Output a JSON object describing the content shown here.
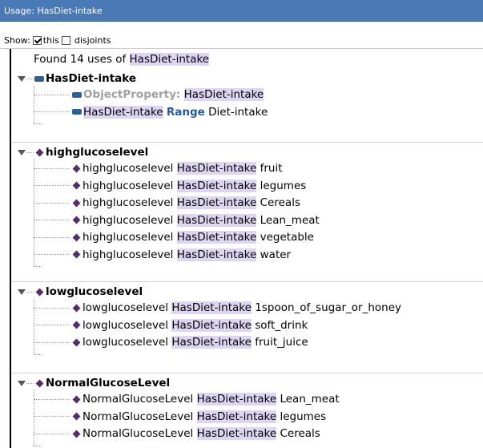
{
  "title": "Usage: HasDiet-intake",
  "toolbar": {
    "show_label": "Show:",
    "this_label": "this",
    "disjoints_label": "disjoints",
    "this_checked": true,
    "disjoints_checked": false
  },
  "found": {
    "prefix": "Found 14 uses of",
    "term": "HasDiet-intake"
  },
  "sections": [
    {
      "title": "HasDiet-intake",
      "icon": "object-property-icon",
      "items": [
        {
          "kind": "objprop",
          "label": "ObjectProperty:",
          "subject": "HasDiet-intake"
        },
        {
          "kind": "range",
          "subject": "HasDiet-intake",
          "keyword": "Range",
          "object": "Diet-intake"
        }
      ]
    },
    {
      "title": "highglucoselevel",
      "icon": "individual-icon",
      "items": [
        {
          "subject": "highglucoselevel",
          "property": "HasDiet-intake",
          "object": "fruit"
        },
        {
          "subject": "highglucoselevel",
          "property": "HasDiet-intake",
          "object": "legumes"
        },
        {
          "subject": "highglucoselevel",
          "property": "HasDiet-intake",
          "object": "Cereals"
        },
        {
          "subject": "highglucoselevel",
          "property": "HasDiet-intake",
          "object": "Lean_meat"
        },
        {
          "subject": "highglucoselevel",
          "property": "HasDiet-intake",
          "object": "vegetable"
        },
        {
          "subject": "highglucoselevel",
          "property": "HasDiet-intake",
          "object": "water"
        }
      ]
    },
    {
      "title": "lowglucoselevel",
      "icon": "individual-icon",
      "items": [
        {
          "subject": "lowglucoselevel",
          "property": "HasDiet-intake",
          "object": "1spoon_of_sugar_or_honey"
        },
        {
          "subject": "lowglucoselevel",
          "property": "HasDiet-intake",
          "object": "soft_drink"
        },
        {
          "subject": "lowglucoselevel",
          "property": "HasDiet-intake",
          "object": "fruit_juice"
        }
      ]
    },
    {
      "title": "NormalGlucoseLevel",
      "icon": "individual-icon",
      "items": [
        {
          "subject": "NormalGlucoseLevel",
          "property": "HasDiet-intake",
          "object": "Lean_meat"
        },
        {
          "subject": "NormalGlucoseLevel",
          "property": "HasDiet-intake",
          "object": "legumes"
        },
        {
          "subject": "NormalGlucoseLevel",
          "property": "HasDiet-intake",
          "object": "Cereals"
        }
      ]
    }
  ],
  "colors": {
    "titlebar": "#4a7ab5",
    "highlight": "#dcd6f2",
    "individual": "#5a2a6e",
    "property": "#2d5f9a",
    "keyword": "#1f5aa6"
  }
}
